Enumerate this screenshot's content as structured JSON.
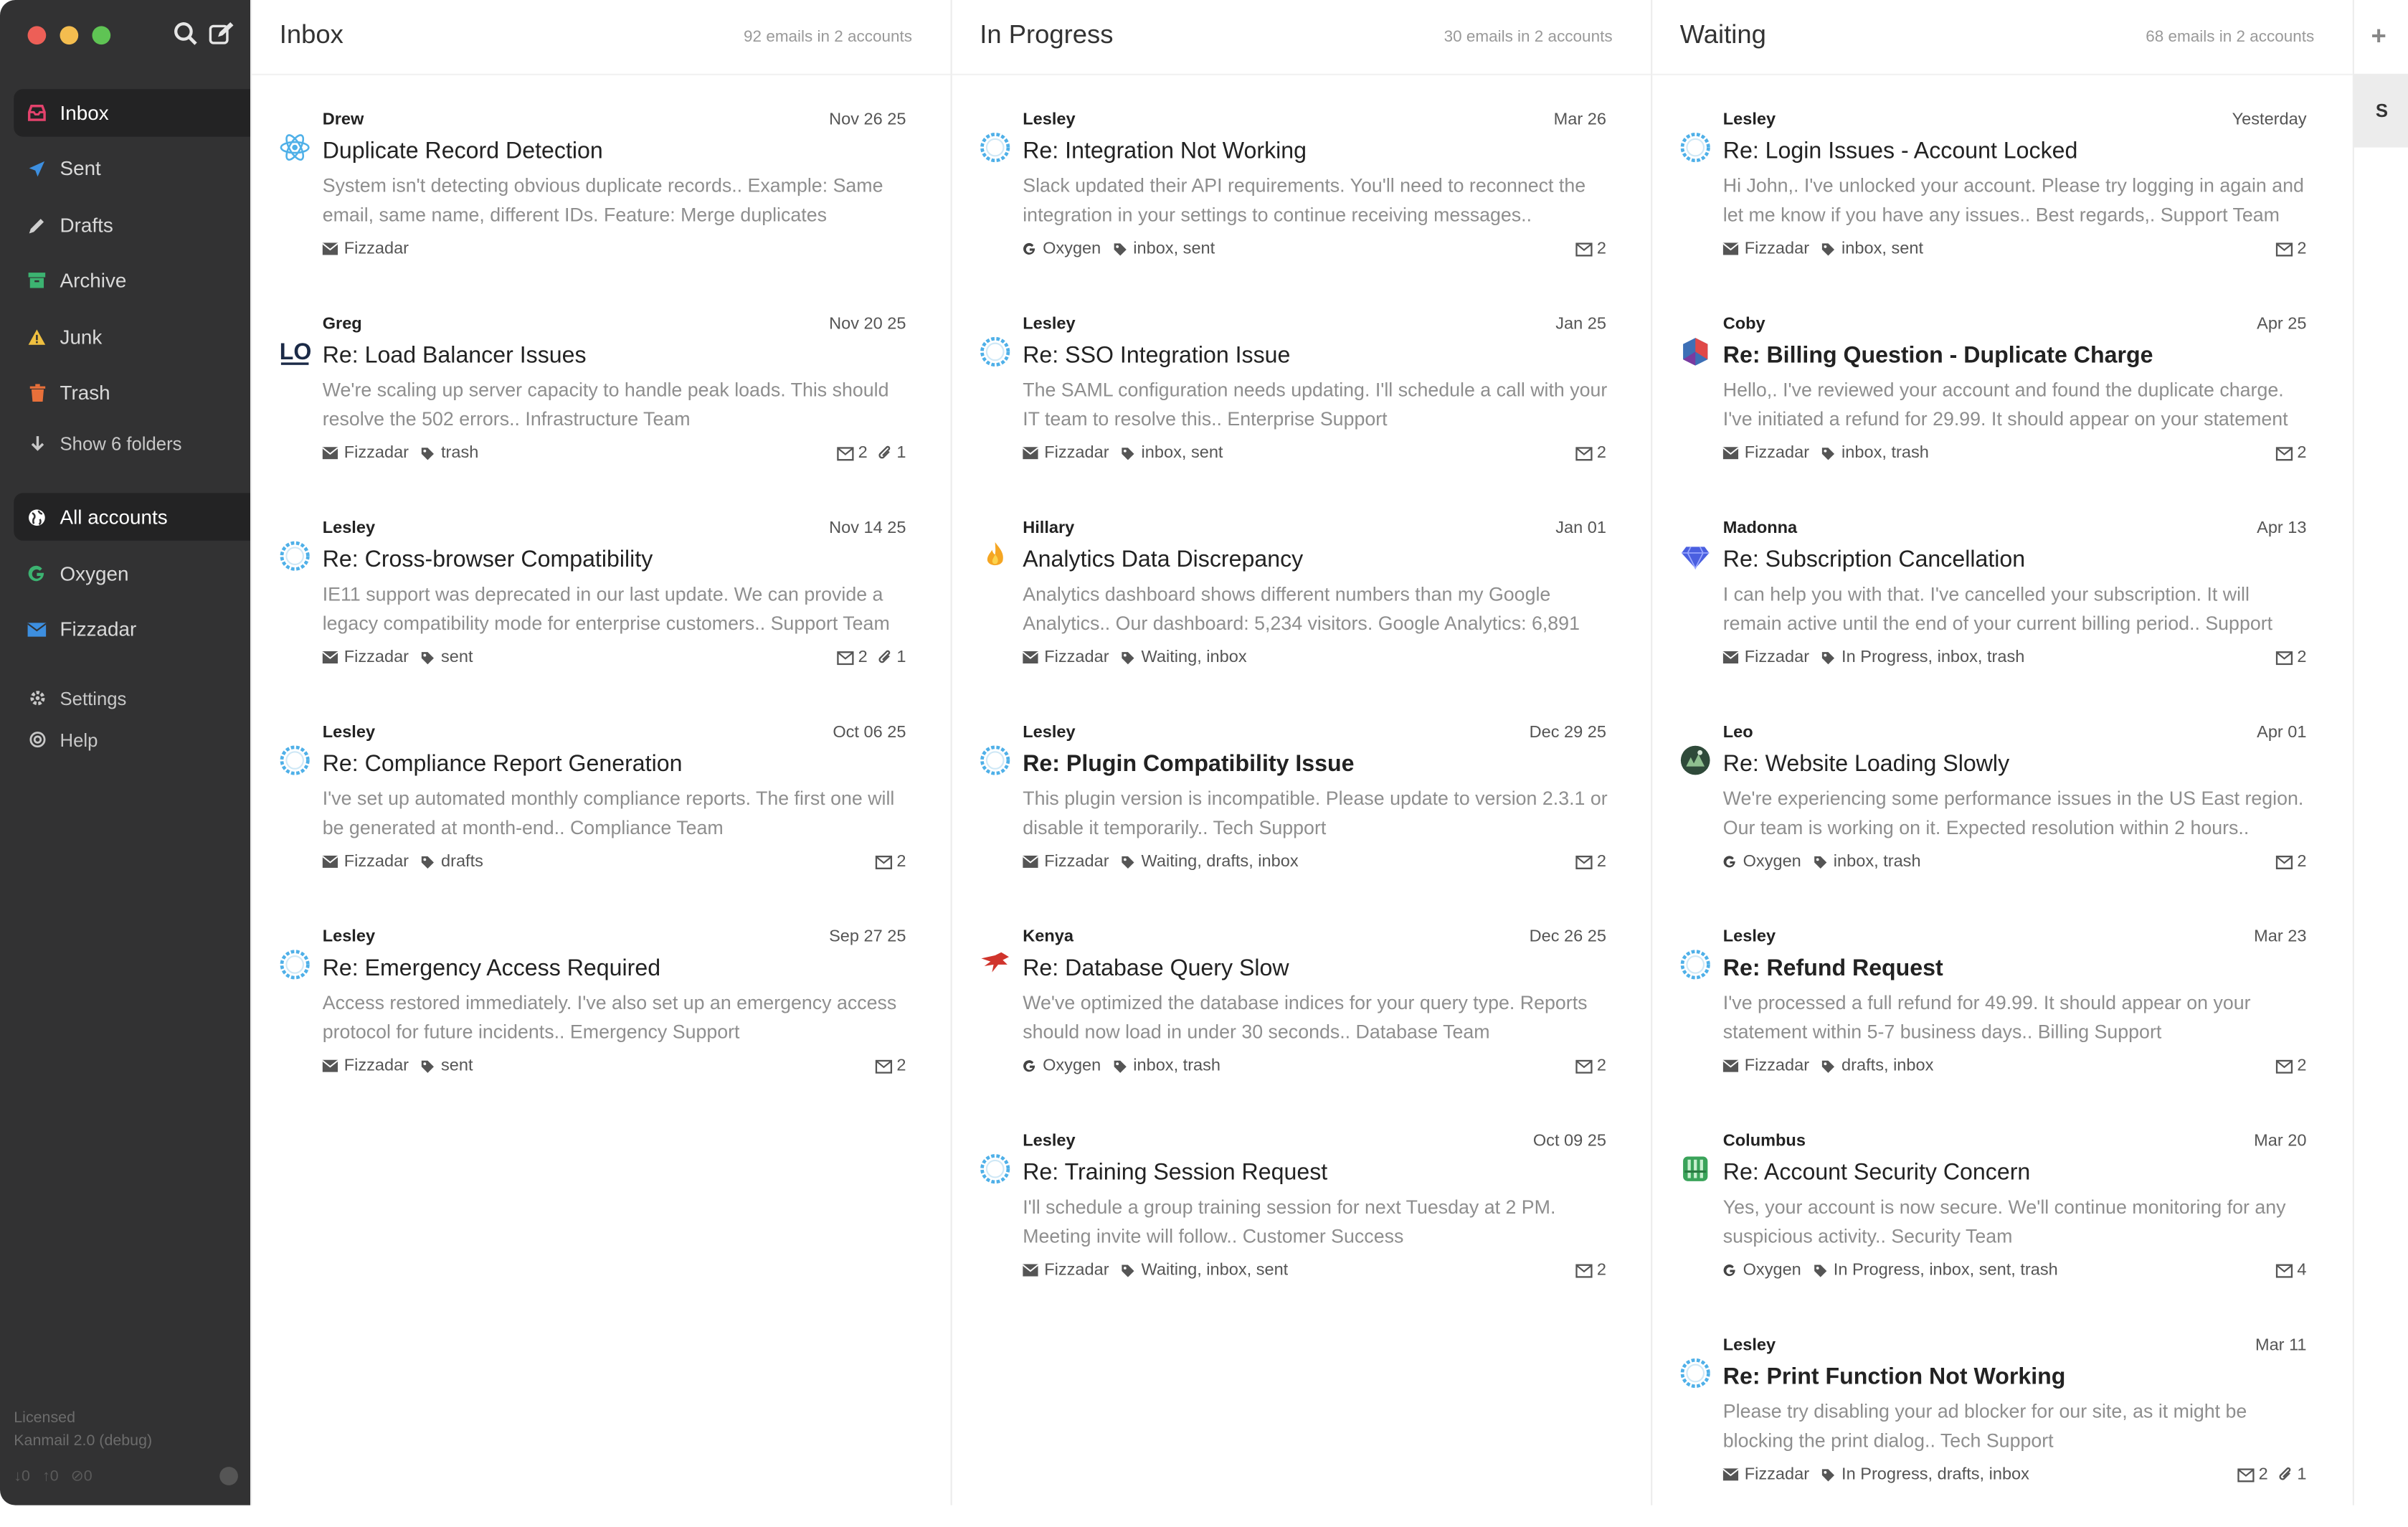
{
  "sidebar": {
    "folders": [
      {
        "label": "Inbox",
        "icon": "inbox-icon",
        "color": "#e3426c"
      },
      {
        "label": "Sent",
        "icon": "send-icon",
        "color": "#3d8fe0"
      },
      {
        "label": "Drafts",
        "icon": "pencil-icon",
        "color": "#cfcfcf"
      },
      {
        "label": "Archive",
        "icon": "archive-icon",
        "color": "#3cb371"
      },
      {
        "label": "Junk",
        "icon": "warning-icon",
        "color": "#f0c040"
      },
      {
        "label": "Trash",
        "icon": "trash-icon",
        "color": "#e8703a"
      }
    ],
    "show_folders": "Show 6 folders",
    "accounts": [
      {
        "label": "All accounts",
        "icon": "globe-icon"
      },
      {
        "label": "Oxygen",
        "icon": "google-icon",
        "color": "#3cb371"
      },
      {
        "label": "Fizzadar",
        "icon": "envelope-icon",
        "color": "#3d8fe0"
      }
    ],
    "settings": "Settings",
    "help": "Help",
    "license": "Licensed",
    "version": "Kanmail 2.0 (debug)",
    "footer_counts": [
      "0",
      "0",
      "0"
    ]
  },
  "columns": [
    {
      "title": "Inbox",
      "count": "92 emails in 2 accounts",
      "emails": [
        {
          "from": "Drew",
          "date": "Nov 26 25",
          "subject": "Duplicate Record Detection",
          "bold": false,
          "preview": "System isn't detecting obvious duplicate records.. Example: Same email, same name, different IDs. Feature: Merge duplicates",
          "account": "Fizzadar",
          "account_icon": "envelope",
          "tags": "",
          "count": "",
          "attach": "",
          "avatar": "react"
        },
        {
          "from": "Greg",
          "date": "Nov 20 25",
          "subject": "Re: Load Balancer Issues",
          "bold": false,
          "preview": "We're scaling up server capacity to handle peak loads. This should resolve the 502 errors.. Infrastructure Team",
          "account": "Fizzadar",
          "account_icon": "envelope",
          "tags": "trash",
          "count": "2",
          "attach": "1",
          "avatar": "lo"
        },
        {
          "from": "Lesley",
          "date": "Nov 14 25",
          "subject": "Re: Cross-browser Compatibility",
          "bold": false,
          "preview": "IE11 support was deprecated in our last update. We can provide a legacy compatibility mode for enterprise customers.. Support Team",
          "account": "Fizzadar",
          "account_icon": "envelope",
          "tags": "sent",
          "count": "2",
          "attach": "1",
          "avatar": "ring"
        },
        {
          "from": "Lesley",
          "date": "Oct 06 25",
          "subject": "Re: Compliance Report Generation",
          "bold": false,
          "preview": "I've set up automated monthly compliance reports. The first one will be generated at month-end.. Compliance Team",
          "account": "Fizzadar",
          "account_icon": "envelope",
          "tags": "drafts",
          "count": "2",
          "attach": "",
          "avatar": "ring"
        },
        {
          "from": "Lesley",
          "date": "Sep 27 25",
          "subject": "Re: Emergency Access Required",
          "bold": false,
          "preview": "Access restored immediately. I've also set up an emergency access protocol for future incidents.. Emergency Support",
          "account": "Fizzadar",
          "account_icon": "envelope",
          "tags": "sent",
          "count": "2",
          "attach": "",
          "avatar": "ring"
        }
      ]
    },
    {
      "title": "In Progress",
      "count": "30 emails in 2 accounts",
      "emails": [
        {
          "from": "Lesley",
          "date": "Mar 26",
          "subject": "Re: Integration Not Working",
          "bold": false,
          "preview": "Slack updated their API requirements. You'll need to reconnect the integration in your settings to continue receiving messages..",
          "account": "Oxygen",
          "account_icon": "google",
          "tags": "inbox, sent",
          "count": "2",
          "attach": "",
          "avatar": "ring"
        },
        {
          "from": "Lesley",
          "date": "Jan 25",
          "subject": "Re: SSO Integration Issue",
          "bold": false,
          "preview": "The SAML configuration needs updating. I'll schedule a call with your IT team to resolve this.. Enterprise Support",
          "account": "Fizzadar",
          "account_icon": "envelope",
          "tags": "inbox, sent",
          "count": "2",
          "attach": "",
          "avatar": "ring"
        },
        {
          "from": "Hillary",
          "date": "Jan 01",
          "subject": "Analytics Data Discrepancy",
          "bold": false,
          "preview": "Analytics dashboard shows different numbers than my Google Analytics.. Our dashboard: 5,234 visitors. Google Analytics: 6,891",
          "account": "Fizzadar",
          "account_icon": "envelope",
          "tags": "Waiting, inbox",
          "count": "",
          "attach": "",
          "avatar": "flame"
        },
        {
          "from": "Lesley",
          "date": "Dec 29 25",
          "subject": "Re: Plugin Compatibility Issue",
          "bold": true,
          "preview": "This plugin version is incompatible. Please update to version 2.3.1 or disable it temporarily.. Tech Support",
          "account": "Fizzadar",
          "account_icon": "envelope",
          "tags": "Waiting, drafts, inbox",
          "count": "2",
          "attach": "",
          "avatar": "ring"
        },
        {
          "from": "Kenya",
          "date": "Dec 26 25",
          "subject": "Re: Database Query Slow",
          "bold": false,
          "preview": "We've optimized the database indices for your query type. Reports should now load in under 30 seconds.. Database Team",
          "account": "Oxygen",
          "account_icon": "google",
          "tags": "inbox, trash",
          "count": "2",
          "attach": "",
          "avatar": "bird"
        },
        {
          "from": "Lesley",
          "date": "Oct 09 25",
          "subject": "Re: Training Session Request",
          "bold": false,
          "preview": "I'll schedule a group training session for next Tuesday at 2 PM. Meeting invite will follow.. Customer Success",
          "account": "Fizzadar",
          "account_icon": "envelope",
          "tags": "Waiting, inbox, sent",
          "count": "2",
          "attach": "",
          "avatar": "ring"
        }
      ]
    },
    {
      "title": "Waiting",
      "count": "68 emails in 2 accounts",
      "emails": [
        {
          "from": "Lesley",
          "date": "Yesterday",
          "subject": "Re: Login Issues - Account Locked",
          "bold": false,
          "preview": "Hi John,. I've unlocked your account. Please try logging in again and let me know if you have any issues.. Best regards,. Support Team",
          "account": "Fizzadar",
          "account_icon": "envelope",
          "tags": "inbox, sent",
          "count": "2",
          "attach": "",
          "avatar": "ring"
        },
        {
          "from": "Coby",
          "date": "Apr 25",
          "subject": "Re: Billing Question - Duplicate Charge",
          "bold": true,
          "preview": "Hello,. I've reviewed your account and found the duplicate charge. I've initiated a refund for 29.99. It should appear on your statement",
          "account": "Fizzadar",
          "account_icon": "envelope",
          "tags": "inbox, trash",
          "count": "2",
          "attach": "",
          "avatar": "hex"
        },
        {
          "from": "Madonna",
          "date": "Apr 13",
          "subject": "Re: Subscription Cancellation",
          "bold": false,
          "preview": "I can help you with that. I've cancelled your subscription. It will remain active until the end of your current billing period.. Support",
          "account": "Fizzadar",
          "account_icon": "envelope",
          "tags": "In Progress, inbox, trash",
          "count": "2",
          "attach": "",
          "avatar": "gem"
        },
        {
          "from": "Leo",
          "date": "Apr 01",
          "subject": "Re: Website Loading Slowly",
          "bold": false,
          "preview": "We're experiencing some performance issues in the US East region. Our team is working on it. Expected resolution within 2 hours..",
          "account": "Oxygen",
          "account_icon": "google",
          "tags": "inbox, trash",
          "count": "2",
          "attach": "",
          "avatar": "dark"
        },
        {
          "from": "Lesley",
          "date": "Mar 23",
          "subject": "Re: Refund Request",
          "bold": true,
          "preview": "I've processed a full refund for 49.99. It should appear on your statement within 5-7 business days.. Billing Support",
          "account": "Fizzadar",
          "account_icon": "envelope",
          "tags": "drafts, inbox",
          "count": "2",
          "attach": "",
          "avatar": "ring"
        },
        {
          "from": "Columbus",
          "date": "Mar 20",
          "subject": "Re: Account Security Concern",
          "bold": false,
          "preview": "Yes, your account is now secure. We'll continue monitoring for any suspicious activity.. Security Team",
          "account": "Oxygen",
          "account_icon": "google",
          "tags": "In Progress, inbox, sent, trash",
          "count": "4",
          "attach": "",
          "avatar": "green"
        },
        {
          "from": "Lesley",
          "date": "Mar 11",
          "subject": "Re: Print Function Not Working",
          "bold": true,
          "preview": "Please try disabling your ad blocker for our site, as it might be blocking the print dialog.. Tech Support",
          "account": "Fizzadar",
          "account_icon": "envelope",
          "tags": "In Progress, drafts, inbox",
          "count": "2",
          "attach": "1",
          "avatar": "ring"
        }
      ]
    }
  ],
  "right_strip": {
    "add": "+",
    "tab": "S"
  }
}
